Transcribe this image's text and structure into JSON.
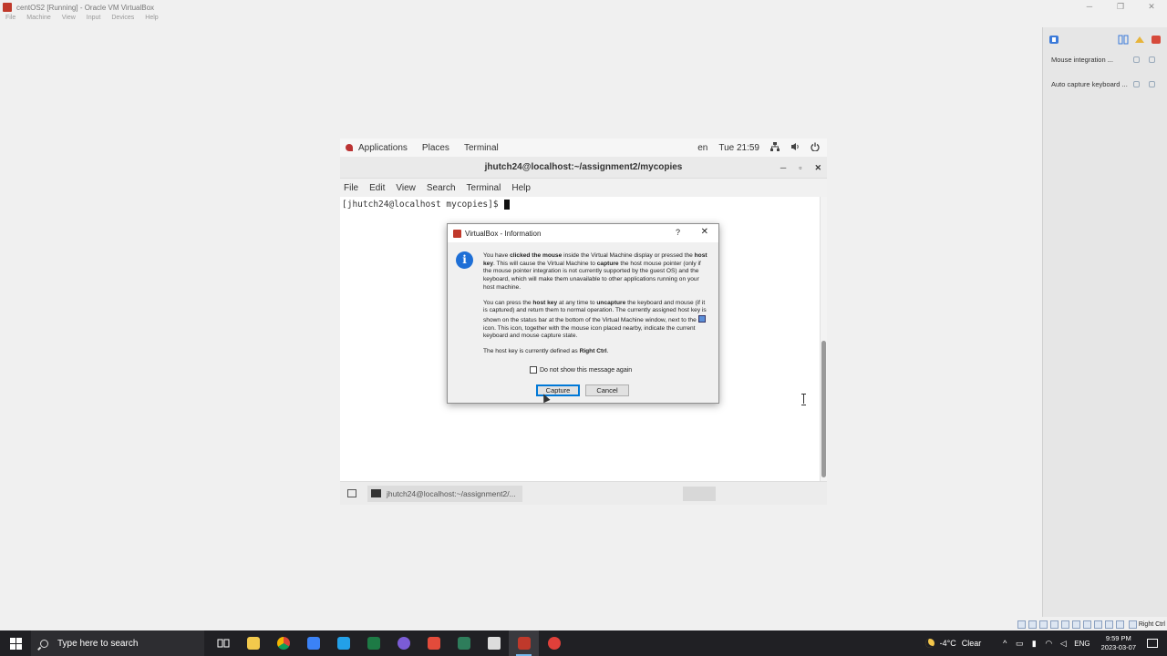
{
  "host": {
    "title": "centOS2 [Running] - Oracle VM VirtualBox",
    "menu": [
      "File",
      "Machine",
      "View",
      "Input",
      "Devices",
      "Help"
    ],
    "controls": [
      "─",
      "❐",
      "✕"
    ]
  },
  "notifications": {
    "items": [
      "Mouse integration ...",
      "Auto capture keyboard ..."
    ]
  },
  "guest": {
    "topbar": {
      "applications": "Applications",
      "places": "Places",
      "terminal": "Terminal",
      "lang": "en",
      "clock": "Tue 21:59"
    },
    "terminal": {
      "title": "jhutch24@localhost:~/assignment2/mycopies",
      "menu": [
        "File",
        "Edit",
        "View",
        "Search",
        "Terminal",
        "Help"
      ],
      "prompt": "[jhutch24@localhost mycopies]$"
    },
    "taskbar": {
      "task": "jhutch24@localhost:~/assignment2/..."
    }
  },
  "dialog": {
    "title": "VirtualBox - Information",
    "help": "?",
    "close": "✕",
    "p1_a": "You have ",
    "p1_b": "clicked the mouse",
    "p1_c": " inside the Virtual Machine display or pressed the ",
    "p1_d": "host key",
    "p1_e": ". This will cause the Virtual Machine to ",
    "p1_f": "capture",
    "p1_g": " the host mouse pointer (only if the mouse pointer integration is not currently supported by the guest OS) and the keyboard, which will make them unavailable to other applications running on your host machine.",
    "p2_a": "You can press the ",
    "p2_b": "host key",
    "p2_c": " at any time to ",
    "p2_d": "uncapture",
    "p2_e": " the keyboard and mouse (if it is captured) and return them to normal operation. The currently assigned host key is shown on the status bar at the bottom of the Virtual Machine window, next to the ",
    "p2_f": " icon. This icon, together with the mouse icon placed nearby, indicate the current keyboard and mouse capture state.",
    "p3_a": "The host key is currently defined as ",
    "p3_b": "Right Ctrl",
    "p3_c": ".",
    "checkbox_label": "Do not show this message again",
    "capture_label": "Capture",
    "cancel_label": "Cancel"
  },
  "vbox_status": {
    "host_key": "Right Ctrl"
  },
  "win_taskbar": {
    "search_placeholder": "Type here to search",
    "temperature": "-4°C",
    "weather": "Clear",
    "lang": "ENG",
    "time": "9:59 PM",
    "date": "2023-03-07",
    "pinned_icons": [
      "task-view-icon",
      "file-explorer-icon",
      "chrome-icon",
      "notepad-icon",
      "vscode-icon",
      "excel-icon",
      "discord-icon",
      "pdf-icon",
      "calculator-icon",
      "unity-icon",
      "virtualbox-icon",
      "obs-icon"
    ]
  },
  "colors": {
    "accent": "#0078d7",
    "info_blue": "#1e6fd6",
    "taskbar": "#202024"
  }
}
